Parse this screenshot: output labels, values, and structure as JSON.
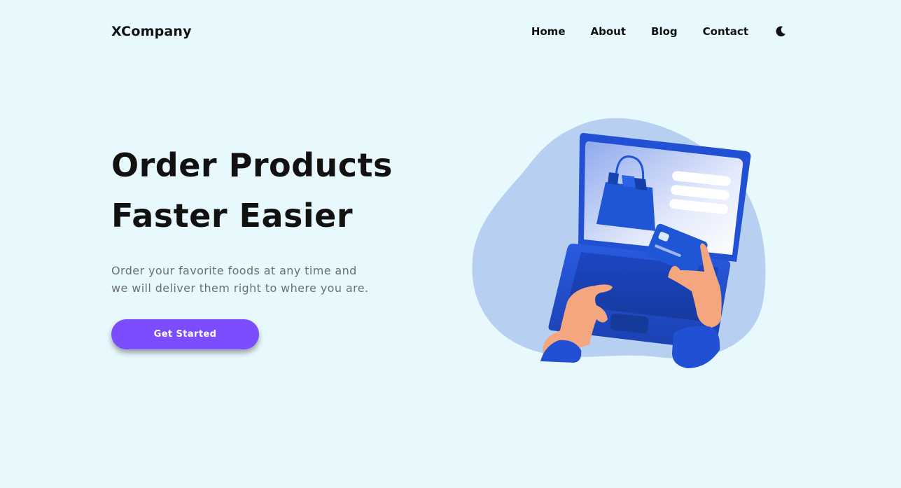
{
  "header": {
    "logo": "XCompany",
    "nav": [
      "Home",
      "About",
      "Blog",
      "Contact"
    ],
    "theme_toggle_icon": "moon-icon"
  },
  "hero": {
    "title_line_1": "Order Products",
    "title_line_2": "Faster Easier",
    "description_line_1": "Order your favorite foods at any time and",
    "description_line_2": "we will deliver them right to where you are.",
    "cta_label": "Get Started"
  },
  "illustration": {
    "icon": "laptop-shopping-illustration"
  },
  "colors": {
    "background": "#e8f9fd",
    "accent": "#7c4dff",
    "illustration_blue": "#1f56d6",
    "blob": "#b7cff0",
    "skin": "#f4a77e"
  }
}
